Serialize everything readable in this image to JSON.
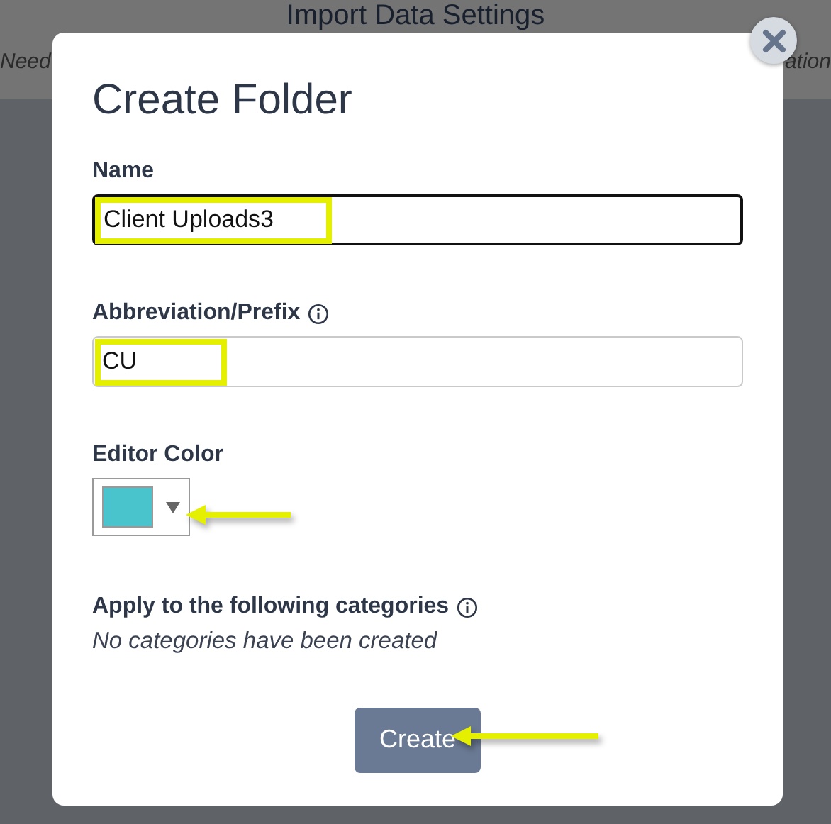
{
  "background": {
    "page_title": "Import Data Settings",
    "left_text": "Need",
    "right_text": "ation"
  },
  "dialog": {
    "title": "Create Folder",
    "fields": [
      {
        "kind": "text",
        "label": "Name",
        "value": "Client Uploads3",
        "focused": true,
        "highlighted": true
      },
      {
        "kind": "text",
        "label": "Abbreviation/Prefix",
        "value": "CU",
        "info": true,
        "focused": false,
        "highlighted": true
      },
      {
        "kind": "color",
        "label": "Editor Color",
        "color": "#4ac4cc",
        "arrow": true
      },
      {
        "kind": "categories",
        "label": "Apply to the following categories",
        "empty_text": "No categories have been created",
        "info": true
      }
    ],
    "button": {
      "label": "Create",
      "arrow": true
    }
  }
}
